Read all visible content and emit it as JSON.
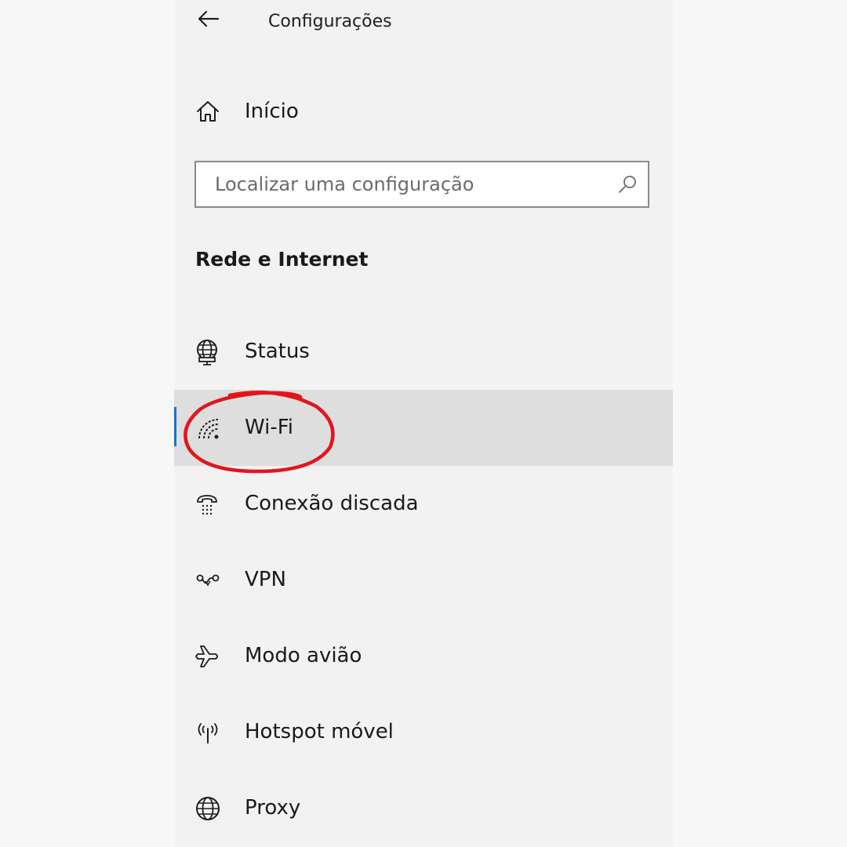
{
  "header": {
    "back_icon": "arrow-left-icon",
    "title": "Configurações"
  },
  "home": {
    "icon": "home-icon",
    "label": "Início"
  },
  "search": {
    "placeholder": "Localizar uma configuração",
    "value": "",
    "icon": "search-icon"
  },
  "section": {
    "heading": "Rede e Internet"
  },
  "nav": {
    "items": [
      {
        "label": "Status",
        "icon": "globe-monitor-icon",
        "selected": false
      },
      {
        "label": "Wi-Fi",
        "icon": "wifi-icon",
        "selected": true
      },
      {
        "label": "Conexão discada",
        "icon": "dial-up-phone-icon",
        "selected": false
      },
      {
        "label": "VPN",
        "icon": "vpn-icon",
        "selected": false
      },
      {
        "label": "Modo avião",
        "icon": "airplane-icon",
        "selected": false
      },
      {
        "label": "Hotspot móvel",
        "icon": "hotspot-icon",
        "selected": false
      },
      {
        "label": "Proxy",
        "icon": "globe-icon",
        "selected": false
      }
    ]
  },
  "colors": {
    "accent": "#0078d4",
    "selected_background": "#dedede",
    "annotation_ring": "#e0161d"
  }
}
